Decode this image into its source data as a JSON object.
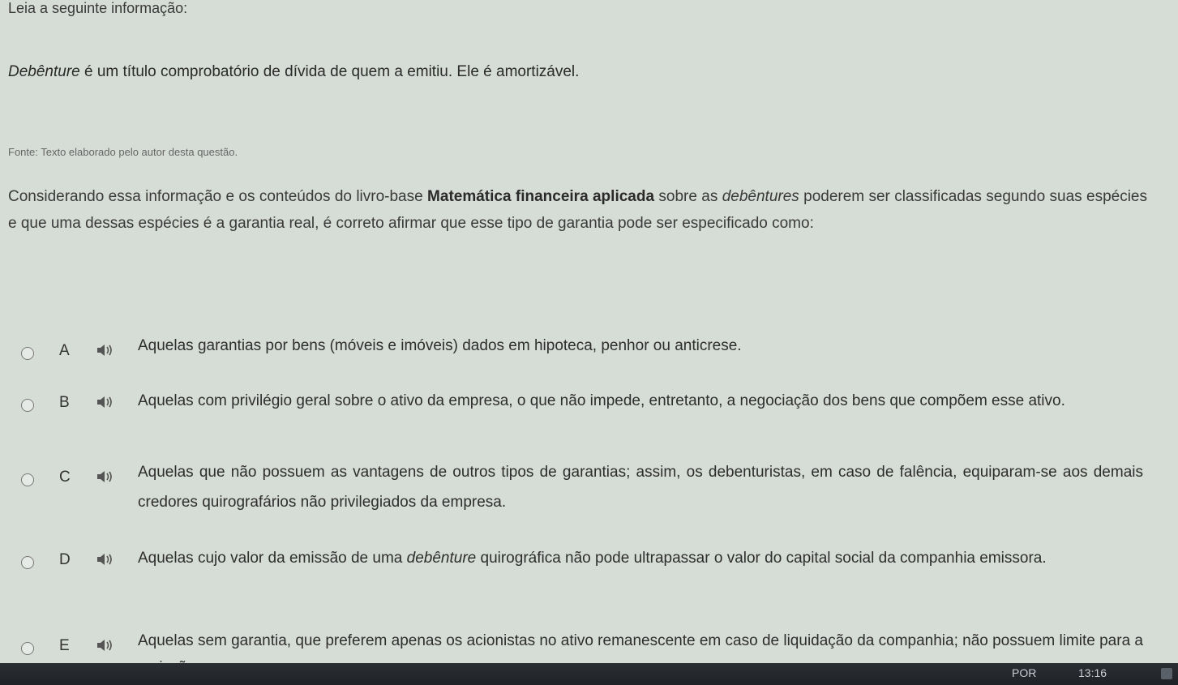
{
  "header": {
    "label": "Leia a seguinte informação:"
  },
  "info": {
    "italic_word": "Debênture",
    "rest": " é um título comprobatório de dívida de quem a emitiu. Ele é amortizável."
  },
  "source": "Fonte: Texto elaborado pelo autor desta questão.",
  "question": {
    "part1": "Considerando essa informação e os conteúdos do livro-base ",
    "bold": "Matemática financeira aplicada",
    "part2": " sobre as ",
    "italic": "debêntures",
    "part3": " poderem ser classificadas segundo suas espécies e que uma dessas espécies é a garantia real, é correto afirmar que esse tipo de garantia pode ser especificado como:"
  },
  "options": [
    {
      "letter": "A",
      "text": "Aquelas garantias por bens (móveis e imóveis) dados em hipoteca, penhor ou anticrese."
    },
    {
      "letter": "B",
      "text": "Aquelas com privilégio geral sobre o ativo da empresa, o que não impede, entretanto, a negociação dos bens que compõem esse ativo."
    },
    {
      "letter": "C",
      "text": "Aquelas que não possuem as vantagens de outros tipos de garantias; assim, os debenturistas, em caso de falência, equiparam-se aos demais credores quirografários não privilegiados da empresa."
    },
    {
      "letter": "D",
      "text_before": "Aquelas cujo valor da emissão de uma ",
      "text_italic": "debênture",
      "text_after": " quirográfica não pode ultrapassar o valor do capital social da companhia emissora."
    },
    {
      "letter": "E",
      "text": "Aquelas sem garantia, que preferem apenas os acionistas no ativo remanescente em caso de liquidação da companhia; não possuem limite para a emissão."
    }
  ],
  "taskbar": {
    "language": "POR",
    "time": "13:16"
  },
  "colors": {
    "background": "#d6dcd6",
    "text": "#2e2e2e",
    "taskbar": "#23262a"
  },
  "icons": {
    "speaker": "speaker-icon",
    "radio": "radio-button"
  }
}
